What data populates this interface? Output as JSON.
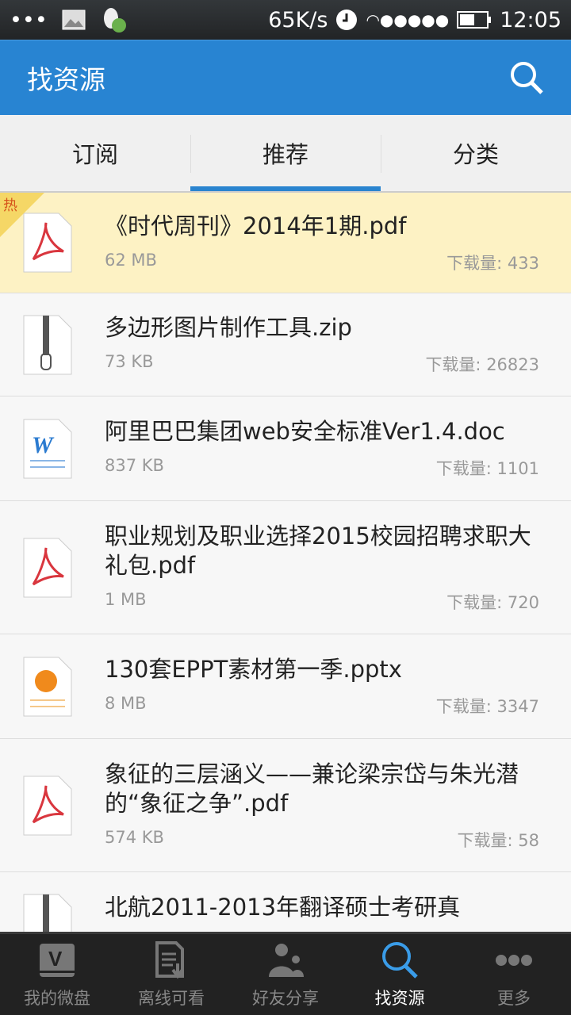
{
  "status_bar": {
    "speed": "65K/s",
    "time": "12:05"
  },
  "header": {
    "title": "找资源"
  },
  "tabs": [
    {
      "label": "订阅"
    },
    {
      "label": "推荐",
      "active": true
    },
    {
      "label": "分类"
    }
  ],
  "hot_label": "热",
  "download_prefix": "下载量: ",
  "items": [
    {
      "name": "《时代周刊》2014年1期.pdf",
      "size": "62 MB",
      "downloads": "下载量: 433",
      "type": "pdf",
      "hot": true
    },
    {
      "name": "多边形图片制作工具.zip",
      "size": "73 KB",
      "downloads": "下载量: 26823",
      "type": "zip"
    },
    {
      "name": "阿里巴巴集团web安全标准Ver1.4.doc",
      "size": "837 KB",
      "downloads": "下载量: 1101",
      "type": "doc"
    },
    {
      "name": "职业规划及职业选择2015校园招聘求职大礼包.pdf",
      "size": "1 MB",
      "downloads": "下载量: 720",
      "type": "pdf"
    },
    {
      "name": "130套EPPT素材第一季.pptx",
      "size": "8 MB",
      "downloads": "下载量: 3347",
      "type": "ppt"
    },
    {
      "name": "象征的三层涵义——兼论梁宗岱与朱光潜的“象征之争”.pdf",
      "size": "574 KB",
      "downloads": "下载量: 58",
      "type": "pdf"
    },
    {
      "name": "北航2011-2013年翻译硕士考研真",
      "size": "",
      "downloads": "",
      "type": "zip"
    }
  ],
  "bottom_nav": [
    {
      "label": "我的微盘",
      "icon": "disk-icon"
    },
    {
      "label": "离线可看",
      "icon": "offline-doc-icon"
    },
    {
      "label": "好友分享",
      "icon": "friends-icon"
    },
    {
      "label": "找资源",
      "icon": "search-icon",
      "active": true
    },
    {
      "label": "更多",
      "icon": "more-icon"
    }
  ],
  "colors": {
    "accent": "#2884d2",
    "hot_bg": "#fdf2c4",
    "nav_bg": "#222222"
  }
}
